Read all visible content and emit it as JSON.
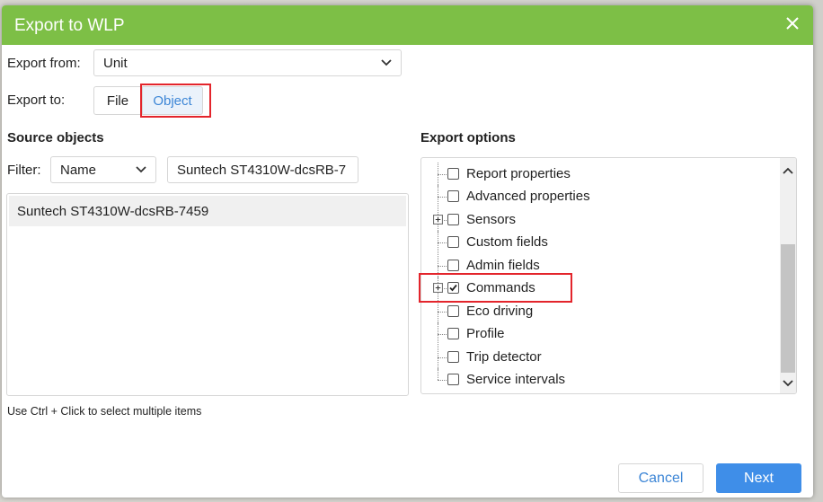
{
  "dialog": {
    "title": "Export to WLP",
    "close_icon": "close-icon"
  },
  "export_from": {
    "label": "Export from:",
    "value": "Unit"
  },
  "export_to": {
    "label": "Export to:",
    "options": [
      "File",
      "Object"
    ],
    "selected": "Object"
  },
  "source": {
    "title": "Source objects",
    "filter_label": "Filter:",
    "filter_type": "Name",
    "filter_value": "Suntech ST4310W-dcsRB-7",
    "items": [
      "Suntech ST4310W-dcsRB-7459"
    ],
    "hint": "Use Ctrl + Click to select multiple items"
  },
  "export_options": {
    "title": "Export options",
    "items": [
      {
        "label": "Report properties",
        "checked": false,
        "expandable": false
      },
      {
        "label": "Advanced properties",
        "checked": false,
        "expandable": false
      },
      {
        "label": "Sensors",
        "checked": false,
        "expandable": true
      },
      {
        "label": "Custom fields",
        "checked": false,
        "expandable": false
      },
      {
        "label": "Admin fields",
        "checked": false,
        "expandable": false
      },
      {
        "label": "Commands",
        "checked": true,
        "expandable": true
      },
      {
        "label": "Eco driving",
        "checked": false,
        "expandable": false
      },
      {
        "label": "Profile",
        "checked": false,
        "expandable": false
      },
      {
        "label": "Trip detector",
        "checked": false,
        "expandable": false
      },
      {
        "label": "Service intervals",
        "checked": false,
        "expandable": false
      }
    ]
  },
  "buttons": {
    "cancel": "Cancel",
    "next": "Next"
  },
  "colors": {
    "titlebar": "#7dbf46",
    "accent": "#3f8ee8",
    "highlight": "#e3252c"
  }
}
